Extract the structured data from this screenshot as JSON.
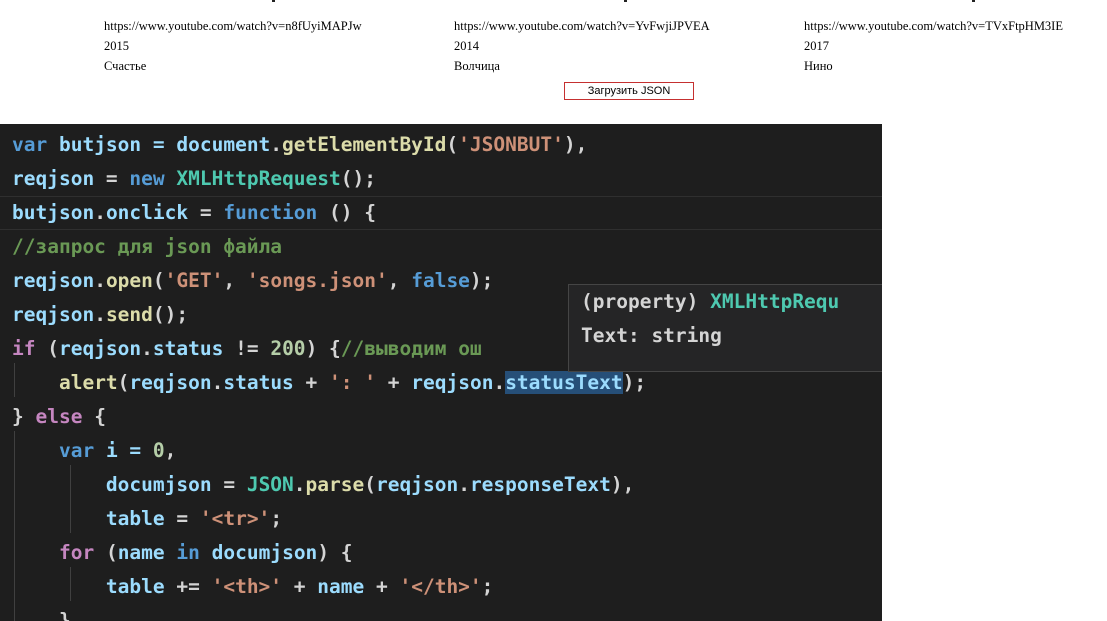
{
  "webpage": {
    "columns": [
      {
        "url": "https://www.youtube.com/watch?v=n8fUyiMAPJw",
        "year": "2015",
        "title": "Счастье"
      },
      {
        "url": "https://www.youtube.com/watch?v=YvFwjiJPVEA",
        "year": "2014",
        "title": "Волчица"
      },
      {
        "url": "https://www.youtube.com/watch?v=TVxFtpHM3IE",
        "year": "2017",
        "title": "Нино"
      }
    ],
    "load_button": "Загрузить JSON"
  },
  "editor": {
    "lines": [
      [
        {
          "t": "var",
          "c": "kw"
        },
        {
          "t": " butjson = ",
          "c": "var"
        },
        {
          "t": "document",
          "c": "var"
        },
        {
          "t": ".",
          "c": "plain"
        },
        {
          "t": "getElementById",
          "c": "fn"
        },
        {
          "t": "(",
          "c": "plain"
        },
        {
          "t": "'JSONBUT'",
          "c": "str"
        },
        {
          "t": "),",
          "c": "plain"
        }
      ],
      [
        {
          "t": "reqjson",
          "c": "var"
        },
        {
          "t": " = ",
          "c": "plain"
        },
        {
          "t": "new",
          "c": "kw"
        },
        {
          "t": " ",
          "c": "plain"
        },
        {
          "t": "XMLHttpRequest",
          "c": "type"
        },
        {
          "t": "();",
          "c": "plain"
        }
      ],
      [
        {
          "t": "butjson",
          "c": "var"
        },
        {
          "t": ".",
          "c": "plain"
        },
        {
          "t": "onclick",
          "c": "var"
        },
        {
          "t": " = ",
          "c": "plain"
        },
        {
          "t": "function",
          "c": "kw"
        },
        {
          "t": " () {",
          "c": "plain"
        }
      ],
      [
        {
          "t": "//запрос для json файла",
          "c": "cmt"
        }
      ],
      [
        {
          "t": "reqjson",
          "c": "var"
        },
        {
          "t": ".",
          "c": "plain"
        },
        {
          "t": "open",
          "c": "fn"
        },
        {
          "t": "(",
          "c": "plain"
        },
        {
          "t": "'GET'",
          "c": "str"
        },
        {
          "t": ", ",
          "c": "plain"
        },
        {
          "t": "'songs.json'",
          "c": "str"
        },
        {
          "t": ", ",
          "c": "plain"
        },
        {
          "t": "false",
          "c": "kw"
        },
        {
          "t": ");",
          "c": "plain"
        }
      ],
      [
        {
          "t": "reqjson",
          "c": "var"
        },
        {
          "t": ".",
          "c": "plain"
        },
        {
          "t": "send",
          "c": "fn"
        },
        {
          "t": "();",
          "c": "plain"
        }
      ],
      [
        {
          "t": "if",
          "c": "kw2"
        },
        {
          "t": " (",
          "c": "plain"
        },
        {
          "t": "reqjson",
          "c": "var"
        },
        {
          "t": ".",
          "c": "plain"
        },
        {
          "t": "status",
          "c": "var"
        },
        {
          "t": " != ",
          "c": "plain"
        },
        {
          "t": "200",
          "c": "num"
        },
        {
          "t": ") {",
          "c": "plain"
        },
        {
          "t": "//выводим ош",
          "c": "cmt"
        }
      ],
      [
        {
          "t": "    ",
          "c": "plain"
        },
        {
          "t": "alert",
          "c": "fn"
        },
        {
          "t": "(",
          "c": "plain"
        },
        {
          "t": "reqjson",
          "c": "var"
        },
        {
          "t": ".",
          "c": "plain"
        },
        {
          "t": "status",
          "c": "var"
        },
        {
          "t": " + ",
          "c": "plain"
        },
        {
          "t": "': '",
          "c": "str"
        },
        {
          "t": " + ",
          "c": "plain"
        },
        {
          "t": "reqjson",
          "c": "var"
        },
        {
          "t": ".",
          "c": "plain"
        },
        {
          "t": "statusText",
          "c": "var hl-word"
        },
        {
          "t": ");",
          "c": "plain"
        }
      ],
      [
        {
          "t": "} ",
          "c": "plain"
        },
        {
          "t": "else",
          "c": "kw2"
        },
        {
          "t": " {",
          "c": "plain"
        }
      ],
      [
        {
          "t": "    ",
          "c": "plain"
        },
        {
          "t": "var",
          "c": "kw"
        },
        {
          "t": " i = ",
          "c": "var"
        },
        {
          "t": "0",
          "c": "num"
        },
        {
          "t": ",",
          "c": "plain"
        }
      ],
      [
        {
          "t": "        ",
          "c": "plain"
        },
        {
          "t": "documjson",
          "c": "var"
        },
        {
          "t": " = ",
          "c": "plain"
        },
        {
          "t": "JSON",
          "c": "type"
        },
        {
          "t": ".",
          "c": "plain"
        },
        {
          "t": "parse",
          "c": "fn"
        },
        {
          "t": "(",
          "c": "plain"
        },
        {
          "t": "reqjson",
          "c": "var"
        },
        {
          "t": ".",
          "c": "plain"
        },
        {
          "t": "responseText",
          "c": "var"
        },
        {
          "t": "),",
          "c": "plain"
        }
      ],
      [
        {
          "t": "        ",
          "c": "plain"
        },
        {
          "t": "table",
          "c": "var"
        },
        {
          "t": " = ",
          "c": "plain"
        },
        {
          "t": "'<tr>'",
          "c": "str"
        },
        {
          "t": ";",
          "c": "plain"
        }
      ],
      [
        {
          "t": "    ",
          "c": "plain"
        },
        {
          "t": "for",
          "c": "kw2"
        },
        {
          "t": " (",
          "c": "plain"
        },
        {
          "t": "name",
          "c": "var"
        },
        {
          "t": " ",
          "c": "plain"
        },
        {
          "t": "in",
          "c": "kw"
        },
        {
          "t": " ",
          "c": "plain"
        },
        {
          "t": "documjson",
          "c": "var"
        },
        {
          "t": ") {",
          "c": "plain"
        }
      ],
      [
        {
          "t": "        ",
          "c": "plain"
        },
        {
          "t": "table",
          "c": "var"
        },
        {
          "t": " += ",
          "c": "plain"
        },
        {
          "t": "'<th>'",
          "c": "str"
        },
        {
          "t": " + ",
          "c": "plain"
        },
        {
          "t": "name",
          "c": "var"
        },
        {
          "t": " + ",
          "c": "plain"
        },
        {
          "t": "'</th>'",
          "c": "str"
        },
        {
          "t": ";",
          "c": "plain"
        }
      ],
      [
        {
          "t": "    }",
          "c": "plain"
        }
      ]
    ],
    "tooltip": {
      "prefix": "(property) ",
      "type_name": "XMLHttpRequ",
      "line2": "Text: string"
    }
  },
  "colors": {
    "editor_bg": "#1e1e1e",
    "button_border": "#c53030"
  }
}
